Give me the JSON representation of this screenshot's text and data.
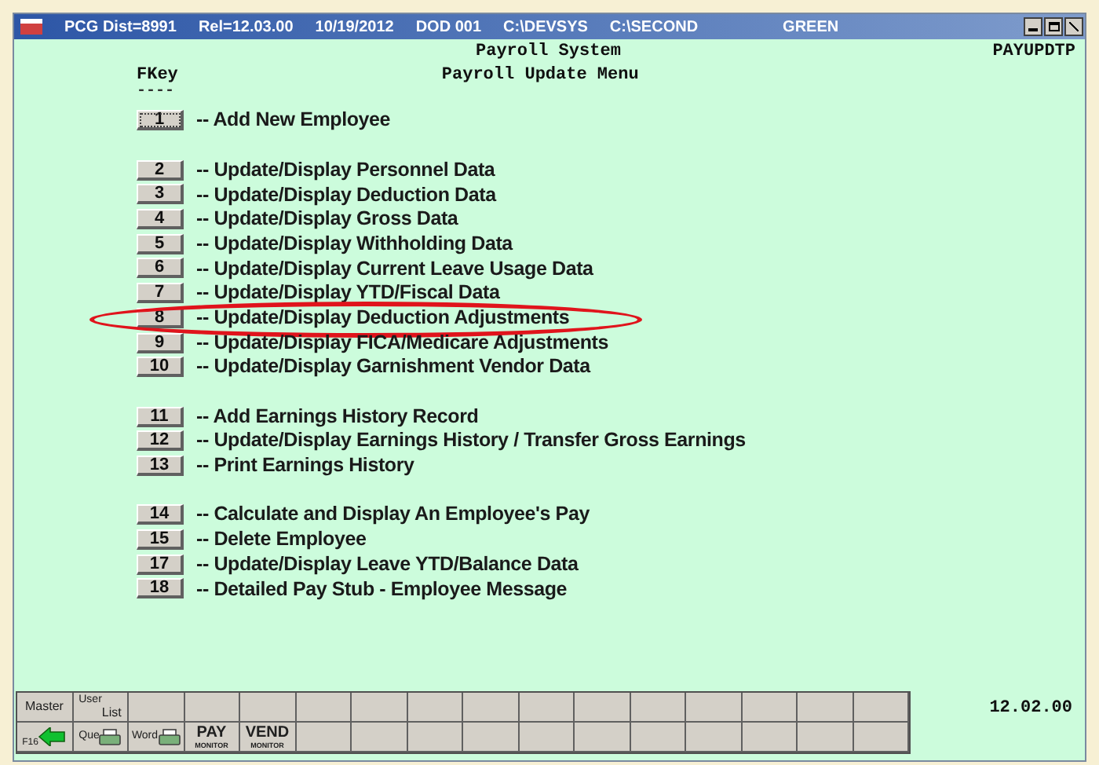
{
  "title_bar": {
    "segments": [
      "PCG Dist=8991",
      "Rel=12.03.00",
      "10/19/2012",
      "DOD 001",
      "C:\\DEVSYS",
      "C:\\SECOND",
      "GREEN"
    ]
  },
  "header": {
    "system": "Payroll System",
    "program": "PAYUPDTP",
    "fkey_label": "FKey",
    "fkey_rule": "----",
    "menu_title": "Payroll Update Menu"
  },
  "menu_groups": [
    [
      {
        "key": "1",
        "label": "-- Add New Employee",
        "focused": true,
        "circled": false
      }
    ],
    [
      {
        "key": "2",
        "label": "-- Update/Display Personnel Data",
        "focused": false,
        "circled": false
      },
      {
        "key": "3",
        "label": "-- Update/Display Deduction Data",
        "focused": false,
        "circled": false
      },
      {
        "key": "4",
        "label": "-- Update/Display Gross Data",
        "focused": false,
        "circled": false
      },
      {
        "key": "5",
        "label": "-- Update/Display Withholding Data",
        "focused": false,
        "circled": false
      },
      {
        "key": "6",
        "label": "-- Update/Display Current Leave Usage Data",
        "focused": false,
        "circled": false
      },
      {
        "key": "7",
        "label": "-- Update/Display YTD/Fiscal Data",
        "focused": false,
        "circled": false
      },
      {
        "key": "8",
        "label": "-- Update/Display Deduction Adjustments",
        "focused": false,
        "circled": true
      },
      {
        "key": "9",
        "label": "-- Update/Display FICA/Medicare Adjustments",
        "focused": false,
        "circled": false
      },
      {
        "key": "10",
        "label": "-- Update/Display Garnishment Vendor Data",
        "focused": false,
        "circled": false
      }
    ],
    [
      {
        "key": "11",
        "label": "-- Add Earnings History Record",
        "focused": false,
        "circled": false
      },
      {
        "key": "12",
        "label": "-- Update/Display Earnings History / Transfer Gross Earnings",
        "focused": false,
        "circled": false
      },
      {
        "key": "13",
        "label": "-- Print Earnings History",
        "focused": false,
        "circled": false
      }
    ],
    [
      {
        "key": "14",
        "label": "-- Calculate and Display An Employee's Pay",
        "focused": false,
        "circled": false
      },
      {
        "key": "15",
        "label": "-- Delete Employee",
        "focused": false,
        "circled": false
      },
      {
        "key": "17",
        "label": "-- Update/Display Leave YTD/Balance Data",
        "focused": false,
        "circled": false
      },
      {
        "key": "18",
        "label": "-- Detailed Pay Stub - Employee Message",
        "focused": false,
        "circled": false
      }
    ]
  ],
  "toolbar": {
    "rows": [
      [
        {
          "kind": "text",
          "text": "Master"
        },
        {
          "kind": "user_list",
          "text": "User",
          "sub": "List"
        },
        {
          "kind": "empty"
        },
        {
          "kind": "empty"
        },
        {
          "kind": "empty"
        },
        {
          "kind": "empty"
        },
        {
          "kind": "empty"
        },
        {
          "kind": "empty"
        },
        {
          "kind": "empty"
        },
        {
          "kind": "empty"
        },
        {
          "kind": "empty"
        },
        {
          "kind": "empty"
        },
        {
          "kind": "empty"
        },
        {
          "kind": "empty"
        },
        {
          "kind": "empty"
        },
        {
          "kind": "empty"
        }
      ],
      [
        {
          "kind": "back",
          "text": "F16"
        },
        {
          "kind": "printer",
          "text": "Que"
        },
        {
          "kind": "printer",
          "text": "Word"
        },
        {
          "kind": "monitor",
          "text": "PAY",
          "sub": "MONITOR"
        },
        {
          "kind": "monitor",
          "text": "VEND",
          "sub": "MONITOR"
        },
        {
          "kind": "empty"
        },
        {
          "kind": "empty"
        },
        {
          "kind": "empty"
        },
        {
          "kind": "empty"
        },
        {
          "kind": "empty"
        },
        {
          "kind": "empty"
        },
        {
          "kind": "empty"
        },
        {
          "kind": "empty"
        },
        {
          "kind": "empty"
        },
        {
          "kind": "empty"
        },
        {
          "kind": "empty"
        }
      ]
    ]
  },
  "version": "12.02.00"
}
